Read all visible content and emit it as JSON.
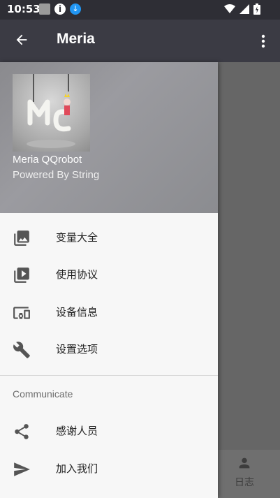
{
  "status_bar": {
    "time": "10:53"
  },
  "app_bar": {
    "title": "Meria"
  },
  "drawer": {
    "header": {
      "name": "Meria QQrobot",
      "subtitle": "Powered By String"
    },
    "items": [
      {
        "label": "变量大全",
        "icon": "photo-library-icon"
      },
      {
        "label": "使用协议",
        "icon": "video-library-icon"
      },
      {
        "label": "设备信息",
        "icon": "devices-icon"
      },
      {
        "label": "设置选项",
        "icon": "wrench-icon"
      }
    ],
    "section_title": "Communicate",
    "section_items": [
      {
        "label": "感谢人员",
        "icon": "share-icon"
      },
      {
        "label": "加入我们",
        "icon": "send-icon"
      }
    ]
  },
  "bottom_nav": {
    "log_label": "日志"
  },
  "colors": {
    "status_bar": "#2e2e35",
    "app_bar": "#3b3b44",
    "drawer_bg": "#f7f7f7",
    "scrim": "#666666",
    "icon": "#555555"
  }
}
